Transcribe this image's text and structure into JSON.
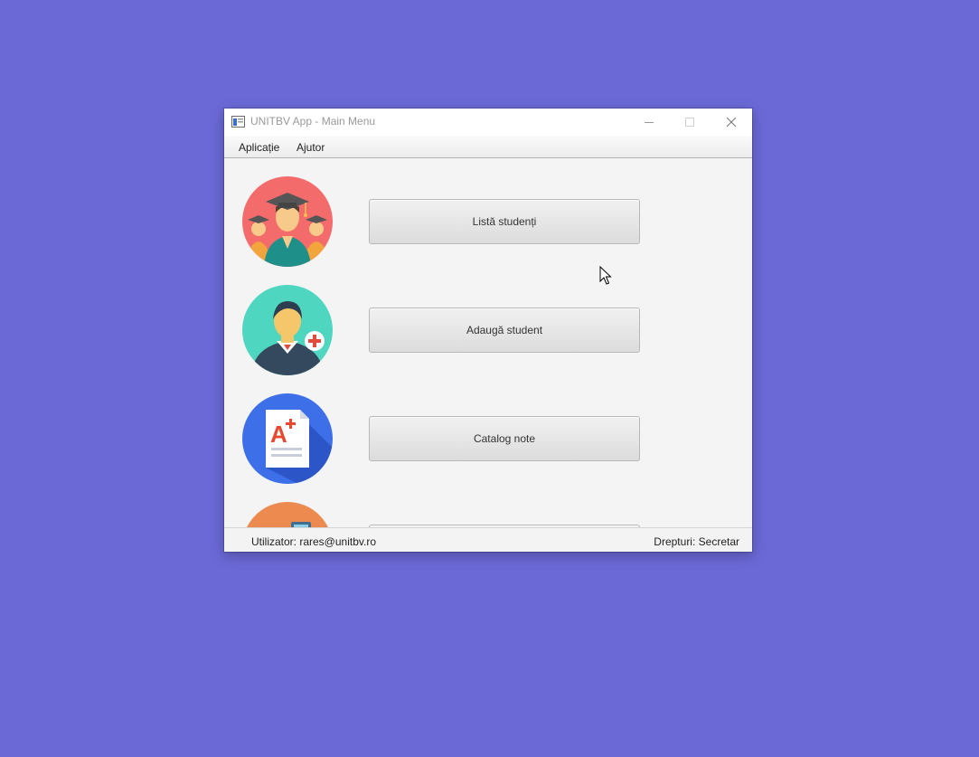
{
  "window": {
    "title": "UNITBV App - Main Menu",
    "controls": {
      "minimize_icon": "minimize-icon",
      "maximize_icon": "maximize-icon",
      "close_icon": "close-icon"
    }
  },
  "menu": {
    "items": [
      {
        "label": "Aplicație"
      },
      {
        "label": "Ajutor"
      }
    ]
  },
  "main": {
    "items": [
      {
        "label": "Listă studenți",
        "icon": "graduates-icon",
        "icon_bg": "#f46b6b"
      },
      {
        "label": "Adaugă student",
        "icon": "add-student-icon",
        "icon_bg": "#4fd6c0"
      },
      {
        "label": "Catalog note",
        "icon": "grade-document-icon",
        "icon_bg": "#3d6fe8"
      },
      {
        "label": "",
        "icon": "partial-icon",
        "icon_bg": "#ec8a4f"
      }
    ]
  },
  "status": {
    "user": "Utilizator: rares@unitbv.ro",
    "rights": "Drepturi: Secretar"
  },
  "colors": {
    "desktop": "#6b69d6",
    "window_bg": "#f3f3f3",
    "button_border": "#b8b8b8"
  }
}
